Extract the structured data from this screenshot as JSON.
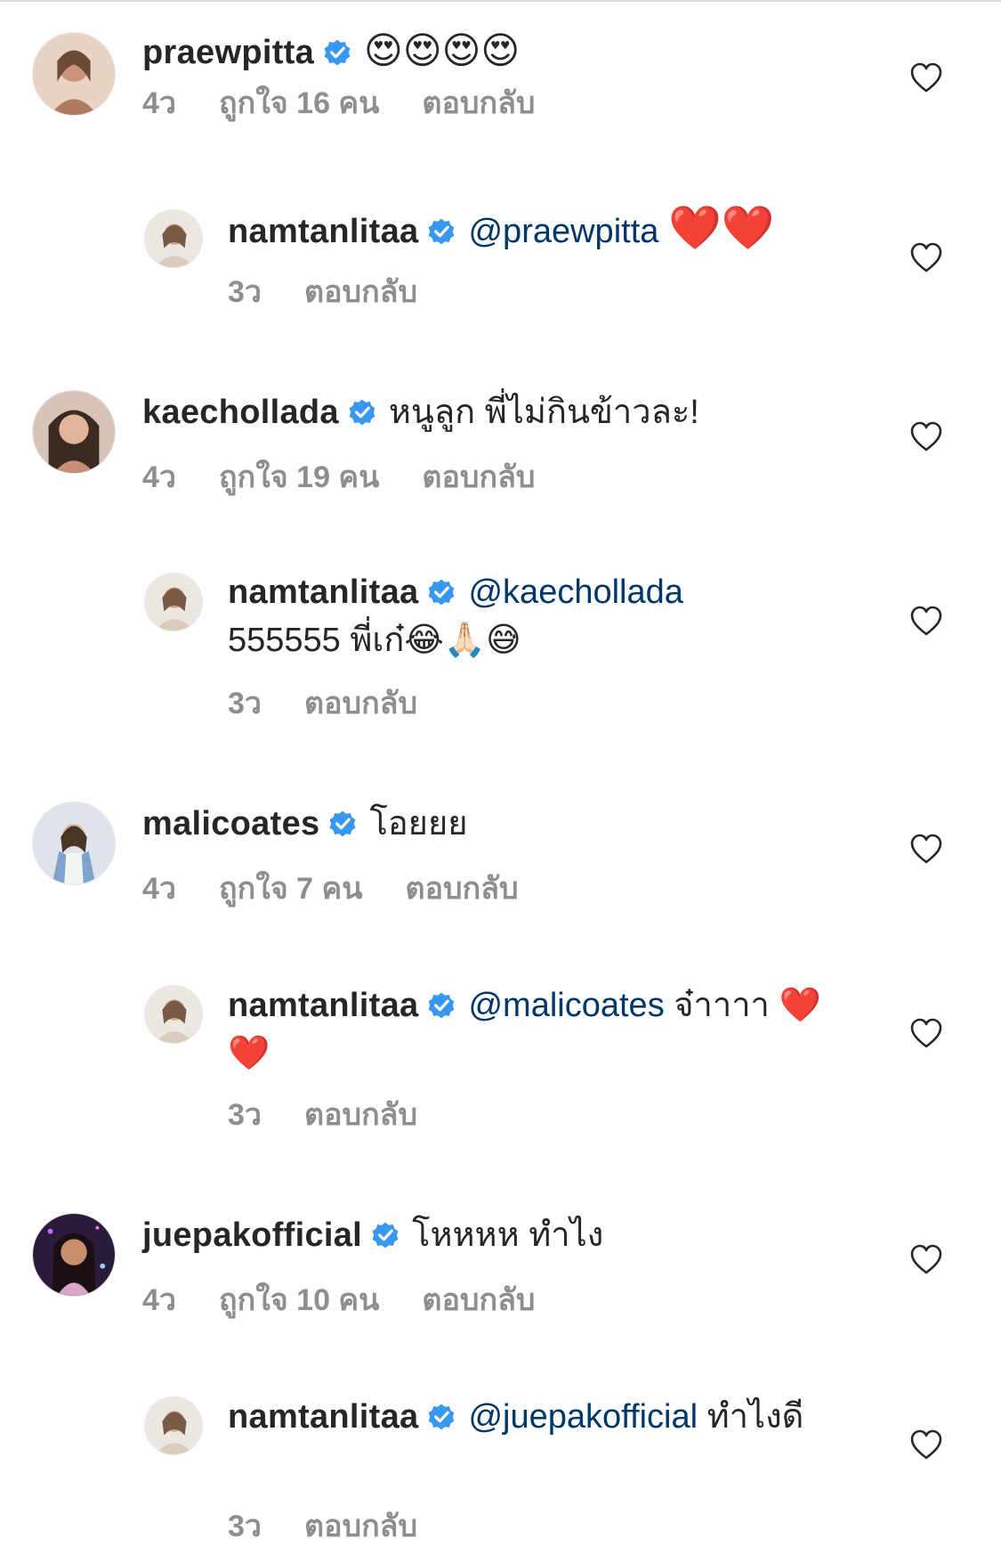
{
  "comments": [
    {
      "username": "praewpitta",
      "text": "😍😍😍😍",
      "time": "4ว",
      "likes": "ถูกใจ 16 คน",
      "reply_label": "ตอบกลับ",
      "reply": {
        "username": "namtanlitaa",
        "mention": "@praewpitta",
        "text": "❤️❤️",
        "time": "3ว",
        "reply_label": "ตอบกลับ"
      }
    },
    {
      "username": "kaechollada",
      "text": "หนูลูก พี่ไม่กินข้าวละ!",
      "time": "4ว",
      "likes": "ถูกใจ 19 คน",
      "reply_label": "ตอบกลับ",
      "reply": {
        "username": "namtanlitaa",
        "mention": "@kaechollada",
        "text": "555555 พี่เก๋😂🙏🏻😅",
        "time": "3ว",
        "reply_label": "ตอบกลับ"
      }
    },
    {
      "username": "malicoates",
      "text": "โอยยย",
      "time": "4ว",
      "likes": "ถูกใจ 7 คน",
      "reply_label": "ตอบกลับ",
      "reply": {
        "username": "namtanlitaa",
        "mention": "@malicoates",
        "text": "จ๋าาาา ❤️❤️",
        "time": "3ว",
        "reply_label": "ตอบกลับ"
      }
    },
    {
      "username": "juepakofficial",
      "text": "โหหหห ทำไง",
      "time": "4ว",
      "likes": "ถูกใจ 10 คน",
      "reply_label": "ตอบกลับ",
      "reply": {
        "username": "namtanlitaa",
        "mention": "@juepakofficial",
        "text": "ทำไงดี",
        "time": "3ว",
        "reply_label": "ตอบกลับ"
      }
    }
  ],
  "colors": {
    "text": "#262626",
    "meta": "#8e8e8e",
    "mention": "#00376b",
    "verified": "#3897f0"
  },
  "icons": {
    "verified": "verified-badge-icon",
    "like": "heart-outline-icon"
  }
}
